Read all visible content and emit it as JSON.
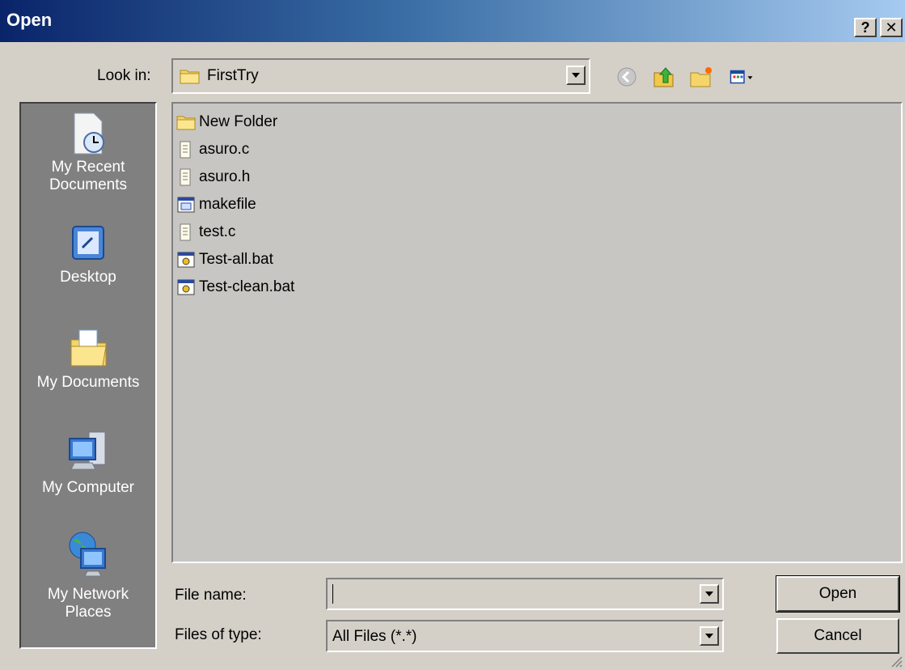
{
  "window": {
    "title": "Open",
    "help_label": "?",
    "close_label": "✕"
  },
  "lookin": {
    "label": "Look in:",
    "value": "FirstTry"
  },
  "toolbar": {
    "icons": [
      "back-icon",
      "up-folder-icon",
      "new-folder-icon",
      "views-menu-icon"
    ]
  },
  "places": [
    {
      "label": "My Recent\nDocuments",
      "icon": "recent-documents-icon"
    },
    {
      "label": "Desktop",
      "icon": "desktop-icon"
    },
    {
      "label": "My Documents",
      "icon": "my-documents-icon"
    },
    {
      "label": "My Computer",
      "icon": "my-computer-icon"
    },
    {
      "label": "My Network\nPlaces",
      "icon": "network-places-icon"
    }
  ],
  "files": [
    {
      "name": "New Folder",
      "icon": "folder-icon"
    },
    {
      "name": "asuro.c",
      "icon": "text-file-icon"
    },
    {
      "name": "asuro.h",
      "icon": "text-file-icon"
    },
    {
      "name": "makefile",
      "icon": "makefile-icon"
    },
    {
      "name": "test.c",
      "icon": "text-file-icon"
    },
    {
      "name": "Test-all.bat",
      "icon": "batch-file-icon"
    },
    {
      "name": "Test-clean.bat",
      "icon": "batch-file-icon"
    }
  ],
  "filename": {
    "label": "File name:",
    "value": ""
  },
  "filetype": {
    "label": "Files of type:",
    "value": "All Files (*.*)"
  },
  "buttons": {
    "open": "Open",
    "cancel": "Cancel"
  },
  "colors": {
    "title_start": "#0a246a",
    "title_end": "#a6caf0",
    "dialog_bg": "#d4d0c8",
    "places_bg": "#808080"
  }
}
